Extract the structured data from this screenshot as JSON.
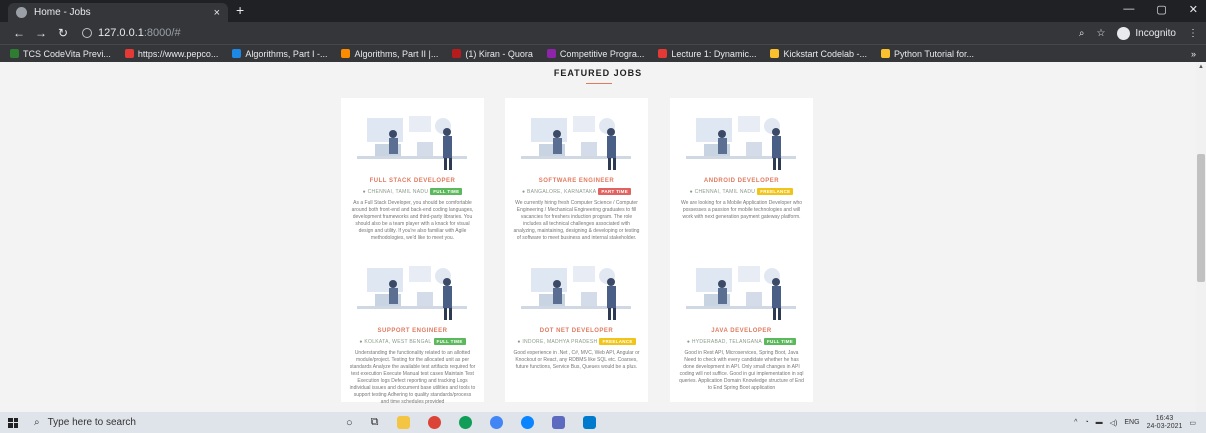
{
  "browser": {
    "tab_title": "Home - Jobs",
    "tab_close": "×",
    "new_tab": "+",
    "url_host": "127.0.0.1",
    "url_path": ":8000/#",
    "incognito_label": "Incognito",
    "bookmarks": [
      {
        "label": "TCS CodeVita Previ...",
        "color": "#2e7d32"
      },
      {
        "label": "https://www.pepco...",
        "color": "#e53935"
      },
      {
        "label": "Algorithms, Part I -...",
        "color": "#1e88e5"
      },
      {
        "label": "Algorithms, Part II |...",
        "color": "#fb8c00"
      },
      {
        "label": "(1) Kiran - Quora",
        "color": "#b71c1c"
      },
      {
        "label": "Competitive Progra...",
        "color": "#8e24aa"
      },
      {
        "label": "Lecture 1: Dynamic...",
        "color": "#e53935"
      },
      {
        "label": "Kickstart Codelab -...",
        "color": "#fbc02d"
      },
      {
        "label": "Python Tutorial for...",
        "color": "#fbc02d"
      }
    ],
    "bookmarks_more": "»"
  },
  "page": {
    "heading": "FEATURED JOBS",
    "jobs": [
      {
        "title": "FULL STACK DEVELOPER",
        "location": "CHENNAI, TAMIL NADU",
        "badge": "FULL TIME",
        "badge_color": "#5cb85c",
        "description": "As a Full Stack Developer, you should be comfortable around both front-end and back-end coding languages, development frameworks and third-party libraries. You should also be a team player with a knack for visual design and utility. If you're also familiar with Agile methodologies, we'd like to meet you."
      },
      {
        "title": "SOFTWARE ENGINEER",
        "location": "BANGALORE, KARNATAKA",
        "badge": "PART TIME",
        "badge_color": "#e0635f",
        "description": "We currently hiring fresh Computer Science / Computer Engineering / Mechanical Engineering graduates to fill vacancies for freshers induction program. The role includes all technical challenges associated with analyzing, maintaining, designing & developing or testing of software to meet business and internal stakeholder."
      },
      {
        "title": "ANDROID DEVELOPER",
        "location": "CHENNAI, TAMIL NADU",
        "badge": "FREELANCE",
        "badge_color": "#f0c419",
        "description": "We are looking for a Mobile Application Developer who possesses a passion for mobile technologies and will work with next generation payment gateway platform."
      },
      {
        "title": "SUPPORT ENGINEER",
        "location": "KOLKATA, WEST BENGAL",
        "badge": "FULL TIME",
        "badge_color": "#5cb85c",
        "description": "Understanding the functionality related to an allotted module/project. Testing for the allocated unit as per standards Analyze the available test artifacts required for test execution Execute Manual test cases Maintain Test Execution logs Defect reporting and tracking Logs individual issues and document base utilities and tools to support testing Adhering to quality standards/process and time schedules provided"
      },
      {
        "title": "DOT NET DEVELOPER",
        "location": "INDORE, MADHYA PRADESH",
        "badge": "FREELANCE",
        "badge_color": "#f0c419",
        "description": "Good experience in .Net , C#, MVC, Web API, Angular or Knockout or React, any RDBMS like SQL etc. Coarses, future functions, Service Bus, Queues would be a plus."
      },
      {
        "title": "JAVA DEVELOPER",
        "location": "HYDERABAD, TELANGANA",
        "badge": "FULL TIME",
        "badge_color": "#5cb85c",
        "description": "Good in Rest API, Microservices, Spring Boot, Java Need to check with every candidate whether he has done development in API. Only small changes in API coding will not suffice. Good in gui implementation in sql queries. Application Domain Knowledge structure of End to End Spring Boot application"
      }
    ]
  },
  "taskbar": {
    "search_placeholder": "Type here to search",
    "lang": "ENG",
    "time": "16:43",
    "date": "24-03-2021"
  }
}
